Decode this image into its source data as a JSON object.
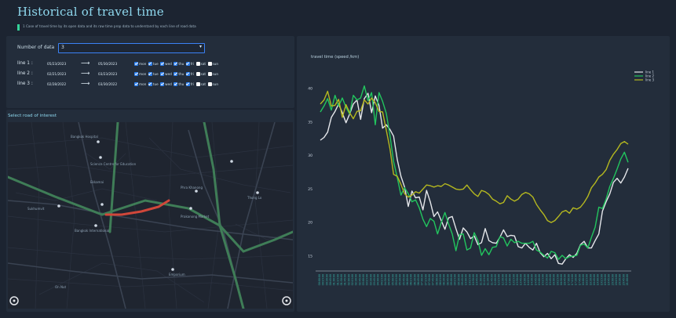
{
  "header": {
    "title": "Historical of travel time",
    "subtitle": "1 Case of travel time by its open data and its raw time prop data to understand by each line of road data"
  },
  "controls": {
    "number_of_data_label": "Number of data",
    "number_of_data_value": "3",
    "day_labels": [
      "mon",
      "tue",
      "wed",
      "thu",
      "fri",
      "sat",
      "sun"
    ],
    "lines": [
      {
        "label": "line 1 :",
        "start": "05/23/2023",
        "arrow": "⟶",
        "end": "05/30/2023",
        "days": [
          true,
          true,
          true,
          true,
          true,
          false,
          false
        ]
      },
      {
        "label": "line 2 :",
        "start": "02/21/2023",
        "arrow": "⟶",
        "end": "03/23/2023",
        "days": [
          true,
          true,
          true,
          true,
          true,
          false,
          false
        ]
      },
      {
        "label": "line 3 :",
        "start": "02/28/2022",
        "arrow": "⟶",
        "end": "03/30/2022",
        "days": [
          true,
          true,
          true,
          true,
          true,
          false,
          false
        ]
      }
    ]
  },
  "map": {
    "title": "Select road of interest",
    "labels": [
      "Bangkok Hospital",
      "Science Centre for Education",
      "Ekkamai",
      "Phra Khanong",
      "Thong Lo",
      "Sukhumvit",
      "Bangkok International",
      "Prakanong Market",
      "Emporium",
      "On Nut"
    ],
    "colors": {
      "background": "#1f2530",
      "road": "#3a4352",
      "major_road": "#4c5566",
      "transit": "#3f7d57",
      "selected_road": "#d0473a"
    }
  },
  "chart_title": "travel time (speed /km)",
  "chart_data": {
    "type": "line",
    "title": "travel time (speed /km)",
    "xlabel": "",
    "ylabel": "",
    "ylim": [
      13,
      42
    ],
    "yticks": [
      15,
      20,
      25,
      30,
      35,
      40
    ],
    "x": [
      "00:00:00",
      "00:15:00",
      "00:30:00",
      "00:45:00",
      "01:00:00",
      "01:15:00",
      "01:30:00",
      "01:45:00",
      "02:00:00",
      "02:15:00",
      "02:30:00",
      "02:45:00",
      "03:00:00",
      "03:15:00",
      "03:30:00",
      "03:45:00",
      "04:00:00",
      "04:15:00",
      "04:30:00",
      "04:45:00",
      "05:00:00",
      "05:15:00",
      "05:30:00",
      "05:45:00",
      "06:00:00",
      "06:15:00",
      "06:30:00",
      "06:45:00",
      "07:00:00",
      "07:15:00",
      "07:30:00",
      "07:45:00",
      "08:00:00",
      "08:15:00",
      "08:30:00",
      "08:45:00",
      "09:00:00",
      "09:15:00",
      "09:30:00",
      "09:45:00",
      "10:00:00",
      "10:15:00",
      "10:30:00",
      "10:45:00",
      "11:00:00",
      "11:15:00",
      "11:30:00",
      "11:45:00",
      "12:00:00",
      "12:15:00",
      "12:30:00",
      "12:45:00",
      "13:00:00",
      "13:15:00",
      "13:30:00",
      "13:45:00",
      "14:00:00",
      "14:15:00",
      "14:30:00",
      "14:45:00",
      "15:00:00",
      "15:15:00",
      "15:30:00",
      "15:45:00",
      "16:00:00",
      "16:15:00",
      "16:30:00",
      "16:45:00",
      "17:00:00",
      "17:15:00",
      "17:30:00",
      "17:45:00",
      "18:00:00",
      "18:15:00",
      "18:30:00",
      "18:45:00",
      "19:00:00",
      "19:15:00",
      "19:30:00",
      "19:45:00",
      "20:00:00",
      "20:15:00",
      "20:30:00",
      "20:45:00",
      "21:00:00"
    ],
    "series": [
      {
        "name": "line 1",
        "color": "#e5e7eb",
        "values": [
          32.3,
          32.7,
          33.5,
          35.7,
          36.6,
          37.7,
          36.4,
          34.9,
          36.2,
          37.7,
          38.3,
          35.4,
          38.5,
          39.3,
          36.4,
          38.9,
          37.5,
          34.1,
          34.6,
          33.9,
          32.9,
          29.4,
          26.9,
          25.3,
          22.4,
          24.7,
          23.7,
          23.8,
          21.9,
          24.8,
          23.1,
          20.9,
          21.6,
          20.3,
          19.0,
          20.7,
          20.9,
          19.1,
          17.5,
          19.2,
          18.6,
          17.6,
          18.0,
          16.7,
          17.0,
          19.1,
          17.3,
          17.0,
          16.9,
          17.8,
          18.9,
          17.9,
          18.1,
          18.0,
          16.4,
          16.2,
          16.9,
          16.3,
          15.9,
          16.9,
          15.5,
          14.9,
          15.4,
          14.6,
          15.2,
          13.9,
          13.8,
          14.6,
          15.2,
          14.8,
          15.4,
          16.7,
          17.2,
          16.2,
          16.2,
          17.3,
          18.3,
          21.7,
          23.1,
          24.3,
          26.0,
          26.6,
          25.9,
          26.8,
          28.1
        ]
      },
      {
        "name": "line 2",
        "color": "#22c55e",
        "values": [
          36.5,
          37.4,
          38.5,
          36.8,
          39.0,
          37.4,
          38.6,
          37.2,
          36.2,
          39.0,
          38.3,
          38.6,
          40.4,
          38.2,
          39.4,
          34.6,
          39.4,
          38.1,
          36.3,
          33.0,
          29.1,
          26.7,
          24.1,
          25.2,
          24.3,
          23.1,
          23.4,
          22.2,
          20.5,
          19.4,
          20.6,
          20.2,
          18.3,
          20.0,
          21.5,
          19.8,
          18.3,
          15.8,
          18.2,
          18.3,
          15.9,
          16.2,
          18.5,
          17.3,
          15.1,
          16.1,
          15.2,
          16.3,
          16.4,
          17.9,
          17.7,
          16.5,
          17.5,
          17.0,
          17.2,
          16.9,
          16.9,
          16.9,
          17.2,
          15.9,
          15.6,
          15.1,
          14.7,
          15.7,
          15.5,
          14.5,
          15.1,
          14.6,
          14.9,
          15.0,
          15.1,
          16.6,
          16.8,
          16.2,
          17.8,
          19.3,
          22.3,
          22.1,
          23.5,
          25.4,
          26.6,
          28.0,
          29.5,
          30.5,
          29.0
        ]
      },
      {
        "name": "line 3",
        "color": "#b5b81f",
        "values": [
          37.7,
          38.3,
          39.6,
          37.4,
          37.5,
          38.4,
          35.7,
          37.6,
          36.4,
          35.5,
          36.6,
          36.7,
          38.3,
          37.7,
          38.6,
          37.9,
          36.6,
          36.5,
          33.8,
          31.0,
          27.2,
          26.9,
          25.7,
          24.3,
          23.8,
          24.1,
          24.6,
          24.4,
          25.0,
          25.6,
          25.5,
          25.3,
          25.5,
          25.4,
          25.8,
          25.6,
          25.3,
          25.0,
          24.9,
          25.0,
          25.6,
          24.9,
          24.3,
          23.9,
          24.8,
          24.6,
          24.2,
          23.5,
          23.2,
          22.8,
          23.0,
          24.0,
          23.5,
          23.2,
          23.5,
          24.2,
          24.5,
          24.3,
          23.8,
          22.7,
          21.9,
          21.2,
          20.3,
          20.0,
          20.3,
          20.9,
          21.6,
          21.8,
          21.4,
          22.2,
          22.0,
          22.3,
          23.0,
          23.9,
          25.2,
          25.9,
          26.8,
          27.2,
          27.9,
          29.3,
          30.2,
          30.9,
          31.8,
          32.1,
          31.7
        ]
      }
    ],
    "legend": "top-right",
    "grid": false
  }
}
